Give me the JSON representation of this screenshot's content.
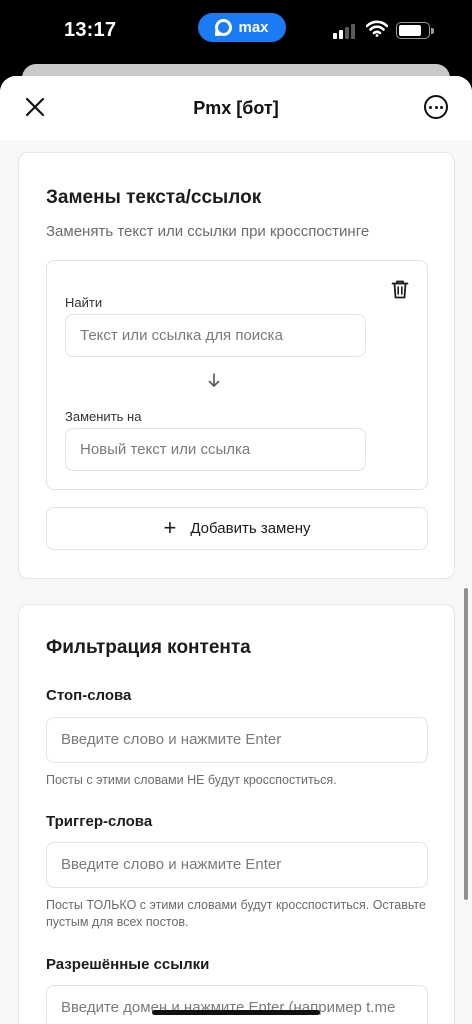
{
  "status": {
    "time": "13:17",
    "app_pill": "max"
  },
  "header": {
    "title": "Pmx [бот]"
  },
  "replacements": {
    "title": "Замены текста/ссылок",
    "subtitle": "Заменять текст или ссылки при кросспостинге",
    "find_label": "Найти",
    "find_placeholder": "Текст или ссылка для поиска",
    "replace_label": "Заменить на",
    "replace_placeholder": "Новый текст или ссылка",
    "add_button": "Добавить замену"
  },
  "filter": {
    "title": "Фильтрация контента",
    "stop_label": "Стоп-слова",
    "stop_placeholder": "Введите слово и нажмите Enter",
    "stop_hint": "Посты с этими словами НЕ будут кросспоститься.",
    "trigger_label": "Триггер-слова",
    "trigger_placeholder": "Введите слово и нажмите Enter",
    "trigger_hint": "Посты ТОЛЬКО с этими словами будут кросспоститься. Оставьте пустым для всех постов.",
    "links_label": "Разрешённые ссылки",
    "links_placeholder": "Введите домен и нажмите Enter (например t.me"
  },
  "icons": {
    "close": "close-icon",
    "more": "more-icon",
    "trash": "trash-icon",
    "arrow": "arrow-down-icon",
    "plus": "plus-icon"
  }
}
